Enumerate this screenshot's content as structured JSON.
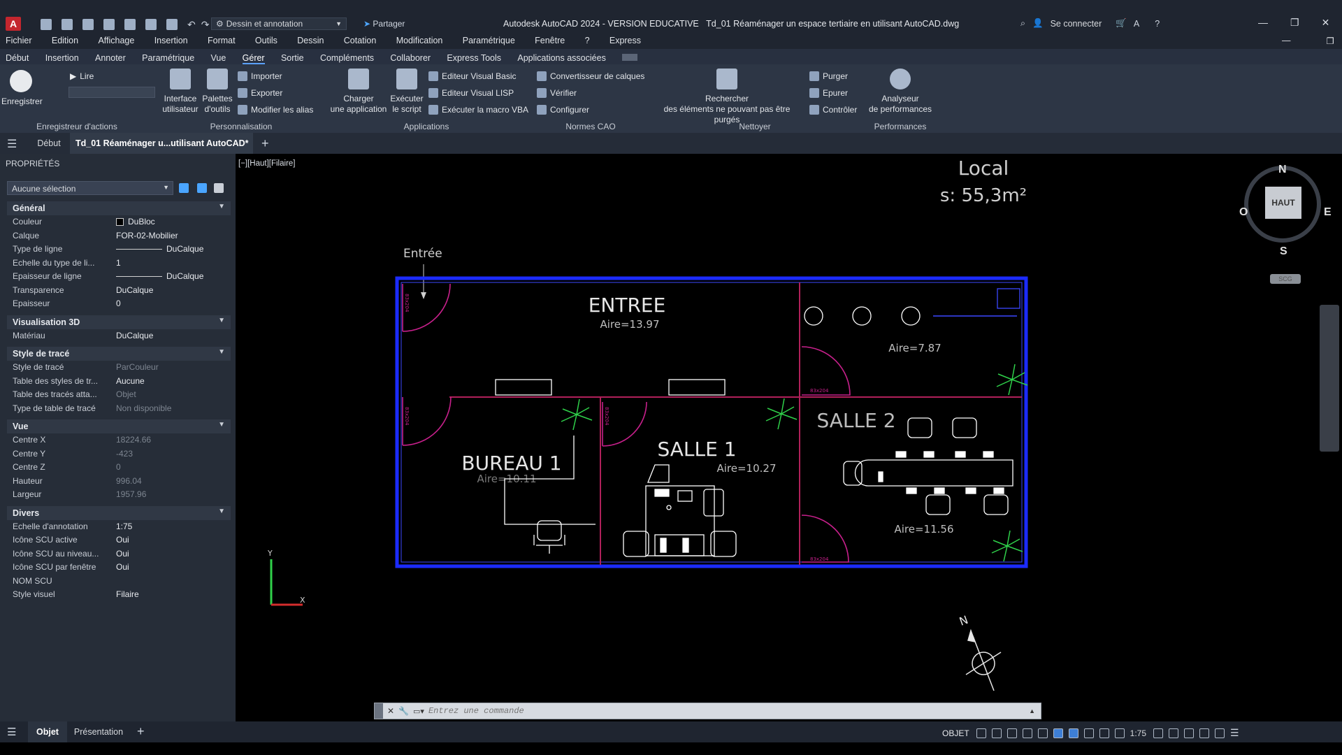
{
  "app": {
    "title": "Autodesk AutoCAD 2024 - VERSION EDUCATIVE",
    "filename": "Td_01 Réaménager un espace tertiaire en utilisant AutoCAD.dwg",
    "workspace": "Dessin et annotation",
    "share": "Partager",
    "signin": "Se connecter"
  },
  "menu": [
    "Fichier",
    "Edition",
    "Affichage",
    "Insertion",
    "Format",
    "Outils",
    "Dessin",
    "Cotation",
    "Modification",
    "Paramétrique",
    "Fenêtre",
    "?",
    "Express"
  ],
  "ribbon_tabs": [
    "Début",
    "Insertion",
    "Annoter",
    "Paramétrique",
    "Vue",
    "Gérer",
    "Sortie",
    "Compléments",
    "Collaborer",
    "Express Tools",
    "Applications associées"
  ],
  "ribbon_active": "Gérer",
  "ribbon": {
    "record": "Enregistrer",
    "play": "Lire",
    "cui_line1": "Interface",
    "cui_line2": "utilisateur",
    "palettes_line1": "Palettes",
    "palettes_line2": "d'outils",
    "import": "Importer",
    "export": "Exporter",
    "aliases": "Modifier les alias",
    "load_app_line1": "Charger",
    "load_app_line2": "une application",
    "run_script_line1": "Exécuter",
    "run_script_line2": "le script",
    "vba_editor": "Editeur Visual Basic",
    "lisp_editor": "Editeur Visual LISP",
    "run_vba": "Exécuter la macro VBA",
    "layer_conv": "Convertisseur de calques",
    "verify": "Vérifier",
    "configure": "Configurer",
    "find_line1": "Rechercher",
    "find_line2": "des éléments ne pouvant pas être purgés",
    "purge": "Purger",
    "overkill": "Epurer",
    "check": "Contrôler",
    "perf_line1": "Analyseur",
    "perf_line2": "de performances",
    "groups": {
      "actions": "Enregistreur d'actions",
      "custom": "Personnalisation",
      "apps": "Applications",
      "cad": "Normes CAO",
      "clean": "Nettoyer",
      "perf": "Performances"
    }
  },
  "doc_tabs": {
    "start": "Début",
    "current": "Td_01 Réaménager u...utilisant AutoCAD*"
  },
  "properties": {
    "title": "PROPRIÉTÉS",
    "selection": "Aucune sélection",
    "sections": {
      "general": "Général",
      "viz3d": "Visualisation 3D",
      "plot": "Style de tracé",
      "view": "Vue",
      "misc": "Divers"
    },
    "general": [
      {
        "k": "Couleur",
        "v": "DuBloc"
      },
      {
        "k": "Calque",
        "v": "FOR-02-Mobilier"
      },
      {
        "k": "Type de ligne",
        "v": "DuCalque"
      },
      {
        "k": "Echelle du type de li...",
        "v": "1"
      },
      {
        "k": "Epaisseur de ligne",
        "v": "DuCalque"
      },
      {
        "k": "Transparence",
        "v": "DuCalque"
      },
      {
        "k": "Epaisseur",
        "v": "0"
      }
    ],
    "viz3d": [
      {
        "k": "Matériau",
        "v": "DuCalque"
      }
    ],
    "plot": [
      {
        "k": "Style de tracé",
        "v": "ParCouleur",
        "dim": true
      },
      {
        "k": "Table des styles de tr...",
        "v": "Aucune",
        "dim": false
      },
      {
        "k": "Table des tracés atta...",
        "v": "Objet",
        "dim": true
      },
      {
        "k": "Type de table de tracé",
        "v": "Non disponible",
        "dim": true
      }
    ],
    "view": [
      {
        "k": "Centre X",
        "v": "18224.66"
      },
      {
        "k": "Centre Y",
        "v": "-423"
      },
      {
        "k": "Centre Z",
        "v": "0"
      },
      {
        "k": "Hauteur",
        "v": "996.04"
      },
      {
        "k": "Largeur",
        "v": "1957.96"
      }
    ],
    "misc": [
      {
        "k": "Echelle d'annotation",
        "v": "1:75"
      },
      {
        "k": "Icône SCU active",
        "v": "Oui"
      },
      {
        "k": "Icône SCU au niveau...",
        "v": "Oui"
      },
      {
        "k": "Icône SCU par fenêtre",
        "v": "Oui"
      },
      {
        "k": "NOM SCU",
        "v": ""
      },
      {
        "k": "Style visuel",
        "v": "Filaire"
      }
    ]
  },
  "viewport": {
    "label": "[−][Haut][Filaire]",
    "local_title": "Local",
    "local_area": "s: 55,3m²",
    "entree_label": "Entrée",
    "rooms": {
      "entree": {
        "name": "ENTREE",
        "area": "Aire=13.97"
      },
      "storage": {
        "area": "Aire=7.87"
      },
      "bureau1": {
        "name": "BUREAU 1",
        "area": "Aire=10.11"
      },
      "salle1": {
        "name": "SALLE 1",
        "area": "Aire=10.27"
      },
      "salle2": {
        "name": "SALLE 2",
        "area": "Aire=11.56"
      }
    },
    "door_tags": [
      "83x204",
      "83x204",
      "83x204",
      "83x204",
      "83x204",
      "83x204"
    ],
    "viewcube": {
      "n": "N",
      "s": "S",
      "e": "E",
      "w": "O",
      "face": "HAUT",
      "scu": "SCG"
    },
    "north": "N",
    "ucs_y": "Y",
    "ucs_x": "X"
  },
  "command": {
    "placeholder": "Entrez une commande"
  },
  "status": {
    "model": "Objet",
    "layout": "Présentation",
    "space": "OBJET",
    "scale": "1:75"
  },
  "colors": {
    "wall": "#1b2bff",
    "partition": "#b0205a",
    "door": "#c8208c",
    "plant": "#2fd14a",
    "furniture": "#ffffff"
  }
}
